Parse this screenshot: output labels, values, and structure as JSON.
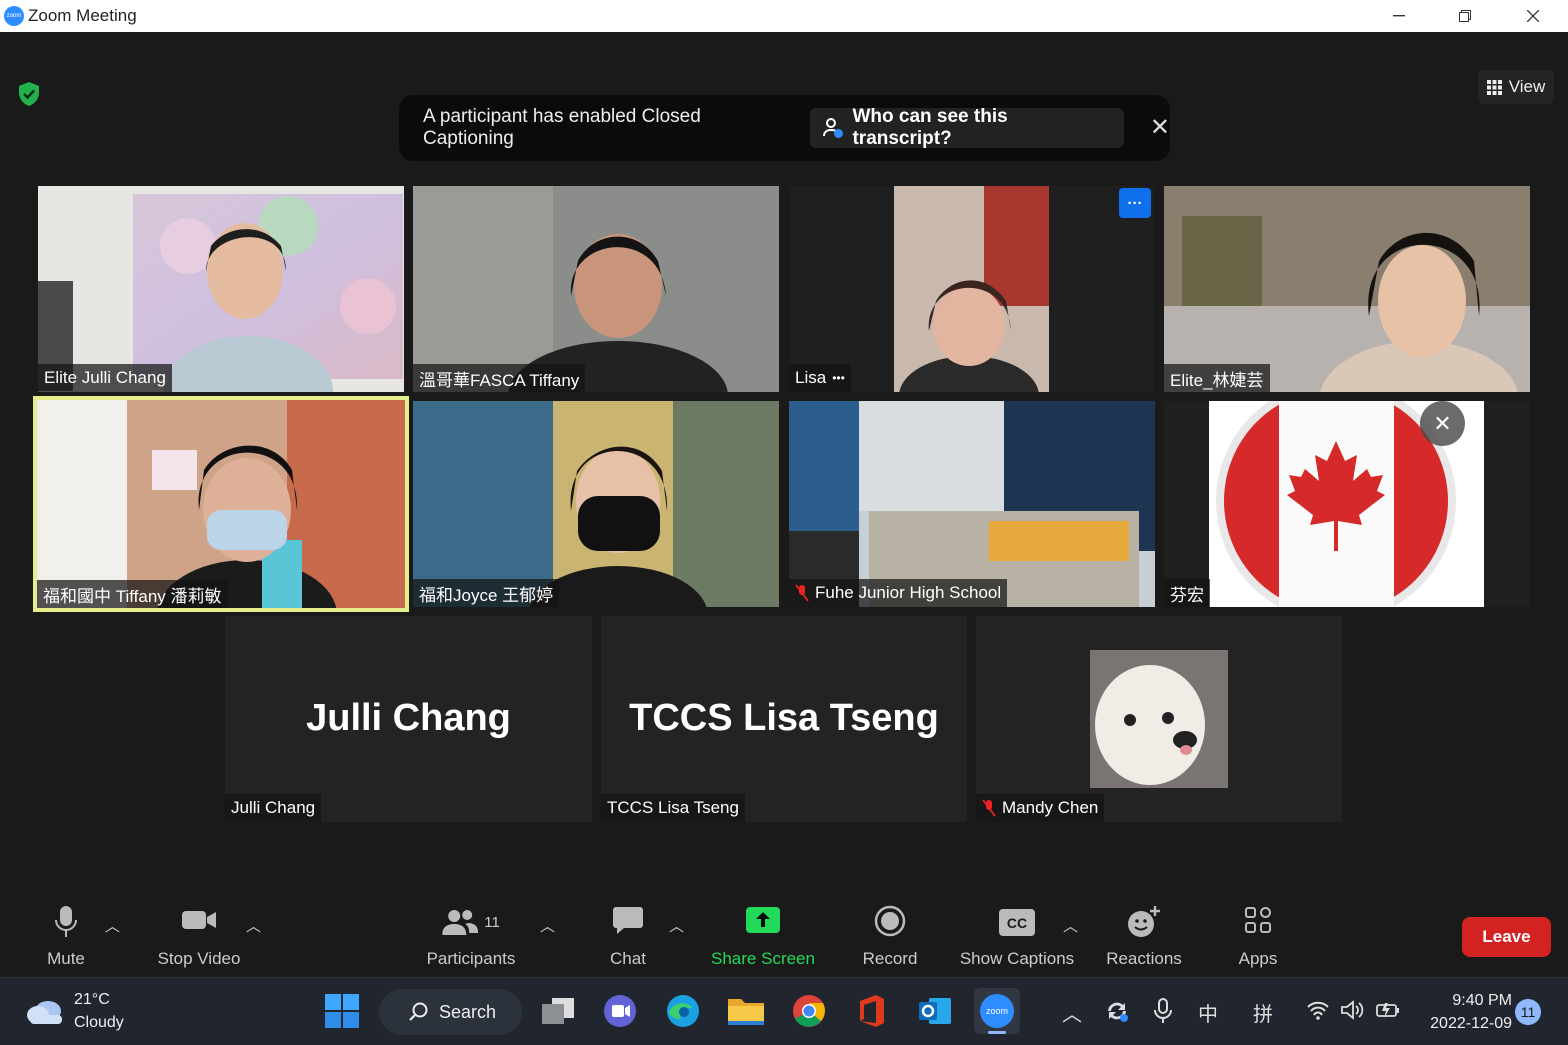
{
  "window": {
    "title": "Zoom Meeting",
    "logo_text": "zoom"
  },
  "top": {
    "view_label": "View"
  },
  "banner": {
    "message": "A participant has enabled Closed Captioning",
    "button_label": "Who can see this transcript?"
  },
  "participants": [
    {
      "name": "Elite Julli Chang",
      "video": true
    },
    {
      "name": "溫哥華FASCA Tiffany",
      "video": true
    },
    {
      "name": "Lisa",
      "video": true
    },
    {
      "name": "Elite_林婕芸",
      "video": true
    },
    {
      "name": "福和國中 Tiffany 潘莉敏",
      "video": true,
      "active_speaker": true
    },
    {
      "name": "福和Joyce 王郁婷",
      "video": true
    },
    {
      "name": "Fuhe Junior High School",
      "video": true,
      "muted": true
    },
    {
      "name": "芬宏",
      "video": true
    },
    {
      "name": "Julli Chang",
      "display_name": "Julli Chang",
      "video": false
    },
    {
      "name": "TCCS Lisa Tseng",
      "display_name": "TCCS Lisa Tseng",
      "video": false
    },
    {
      "name": "Mandy Chen",
      "video": false,
      "muted": true
    }
  ],
  "toolbar": {
    "mute": "Mute",
    "stop_video": "Stop Video",
    "participants": "Participants",
    "participants_count": "11",
    "chat": "Chat",
    "share_screen": "Share Screen",
    "record": "Record",
    "show_captions": "Show Captions",
    "cc_text": "CC",
    "reactions": "Reactions",
    "apps": "Apps",
    "leave": "Leave"
  },
  "colors": {
    "accent_green": "#23d959",
    "leave_red": "#d32222",
    "speaker_border": "#e5ef8a",
    "zoom_blue": "#2d8cff"
  },
  "taskbar": {
    "weather_temp": "21°C",
    "weather_desc": "Cloudy",
    "search_label": "Search",
    "zoom_label": "zoom",
    "ime_1": "中",
    "ime_2": "拼",
    "time": "9:40 PM",
    "date": "2022-12-09",
    "notification_count": "11"
  }
}
